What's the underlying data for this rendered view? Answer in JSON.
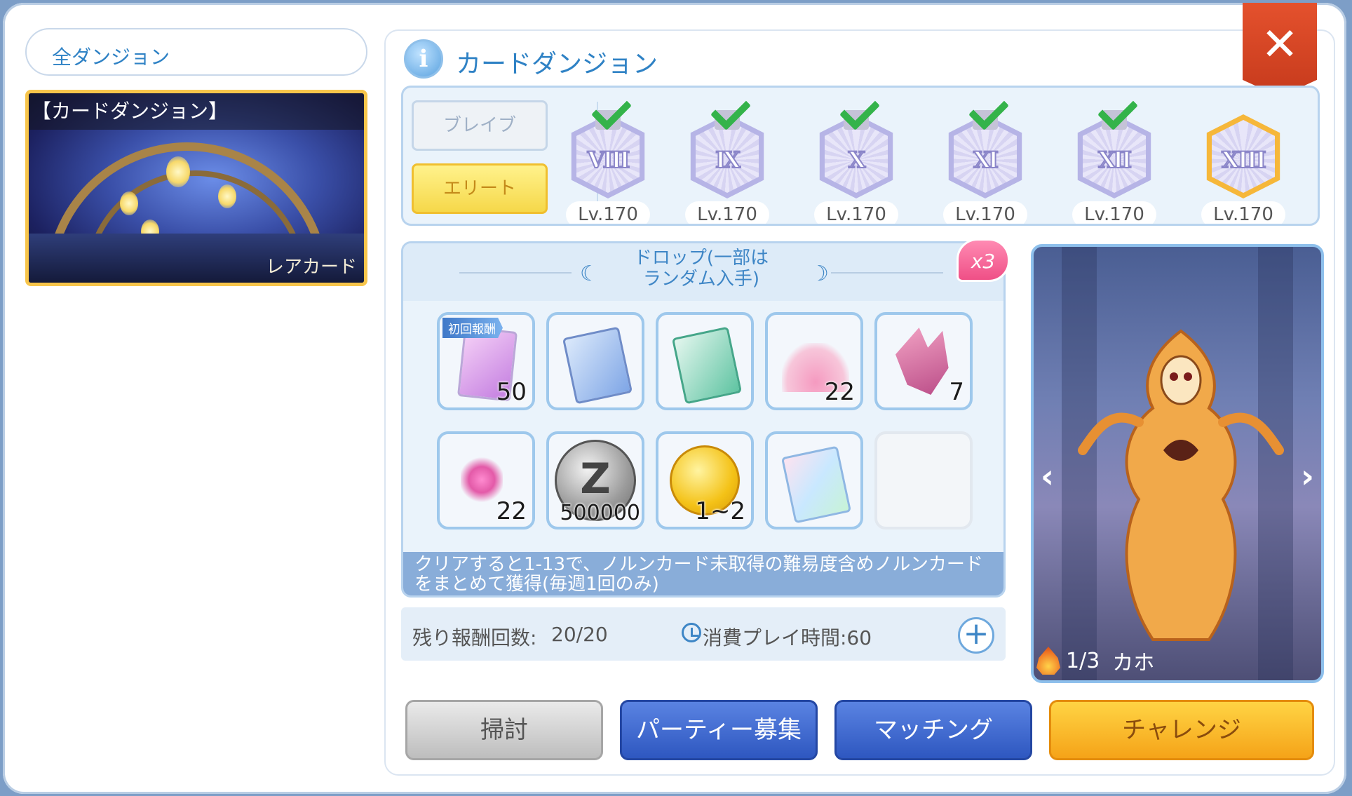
{
  "sidebar": {
    "all_dungeons_label": "全ダンジョン",
    "selected_card": {
      "title": "【カードダンジョン】",
      "tag": "レアカード"
    }
  },
  "header": {
    "info_icon": "i",
    "title": "カードダンジョン",
    "close_label": "✕"
  },
  "modes": {
    "brave": "ブレイブ",
    "elite": "エリート",
    "selected": "エリート"
  },
  "levels": [
    {
      "numeral": "Ⅷ",
      "label": "Lv.170",
      "cleared": true,
      "active": false
    },
    {
      "numeral": "Ⅸ",
      "label": "Lv.170",
      "cleared": true,
      "active": false
    },
    {
      "numeral": "Ⅹ",
      "label": "Lv.170",
      "cleared": true,
      "active": false
    },
    {
      "numeral": "Ⅺ",
      "label": "Lv.170",
      "cleared": true,
      "active": false
    },
    {
      "numeral": "Ⅻ",
      "label": "Lv.170",
      "cleared": true,
      "active": false
    },
    {
      "numeral": "XIII",
      "label": "Lv.170",
      "cleared": false,
      "active": true
    }
  ],
  "drops": {
    "title_line1": "ドロップ(一部は",
    "title_line2": "ランダム入手)",
    "multiplier": "x3",
    "first_reward_badge": "初回報酬",
    "items": [
      {
        "icon": "pink-gem-card",
        "qty": "50",
        "first": true
      },
      {
        "icon": "blue-card",
        "qty": ""
      },
      {
        "icon": "green-card",
        "qty": ""
      },
      {
        "icon": "pink-dust",
        "qty": "22"
      },
      {
        "icon": "pink-crystal",
        "qty": "7"
      },
      {
        "icon": "pink-spark",
        "qty": "22"
      },
      {
        "icon": "zeny-coin",
        "qty": "500000"
      },
      {
        "icon": "cat-coin",
        "qty": "1~2"
      },
      {
        "icon": "rainbow-card",
        "qty": ""
      },
      {
        "icon": "empty-slot",
        "qty": ""
      }
    ],
    "note": "クリアすると1-13で、ノルンカード未取得の難易度含めノルンカードをまとめて獲得(毎週1回のみ)"
  },
  "counts": {
    "remaining_label": "残り報酬回数:",
    "remaining_value": "20/20",
    "time_label": "消費プレイ時間:60",
    "plus_label": "+"
  },
  "boss": {
    "page": "1/3",
    "name": "カホ",
    "prev": "‹",
    "next": "›"
  },
  "actions": {
    "sweep": "掃討",
    "party": "パーティー募集",
    "matching": "マッチング",
    "challenge": "チャレンジ"
  },
  "colors": {
    "accent_blue": "#2f82c5",
    "elite_yellow": "#f6d84a",
    "challenge_orange": "#f5a318",
    "close_red": "#d8462a"
  }
}
